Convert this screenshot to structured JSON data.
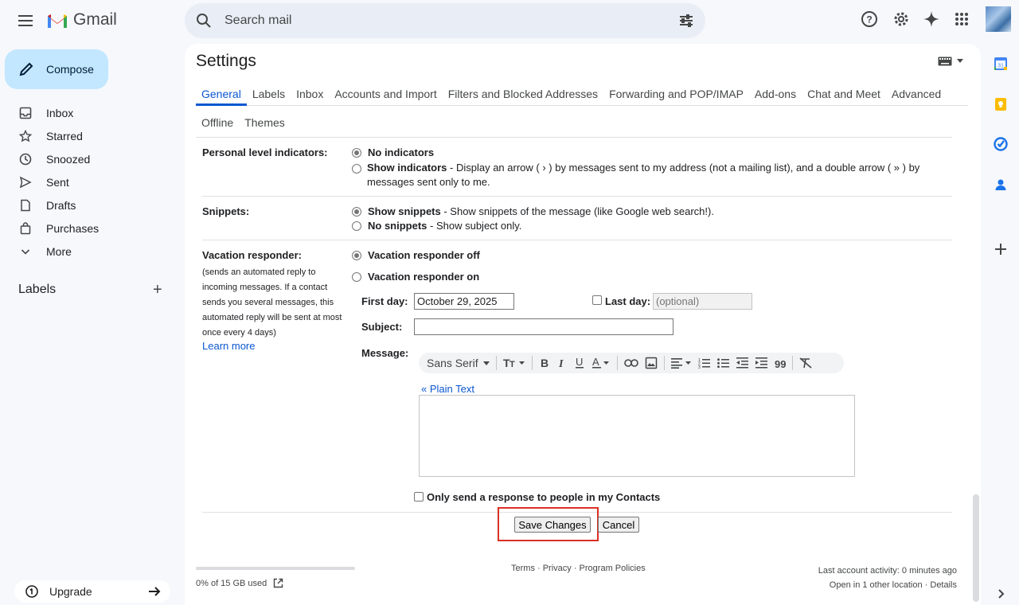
{
  "app": {
    "name": "Gmail"
  },
  "search": {
    "placeholder": "Search mail"
  },
  "icons": {
    "menu": "hamburger-icon",
    "help": "help-icon",
    "settings": "gear-icon",
    "gemini": "sparkle-icon",
    "apps": "apps-grid-icon"
  },
  "colors": {
    "accent": "#0b57d0",
    "compose_bg": "#c2e7ff",
    "highlight": "#d93025"
  },
  "compose": {
    "label": "Compose"
  },
  "nav": {
    "items": [
      {
        "label": "Inbox",
        "icon": "inbox-icon"
      },
      {
        "label": "Starred",
        "icon": "star-icon"
      },
      {
        "label": "Snoozed",
        "icon": "clock-icon"
      },
      {
        "label": "Sent",
        "icon": "send-icon"
      },
      {
        "label": "Drafts",
        "icon": "draft-icon"
      },
      {
        "label": "Purchases",
        "icon": "bag-icon"
      },
      {
        "label": "More",
        "icon": "chevron-down-icon"
      }
    ],
    "labels_heading": "Labels",
    "upgrade": "Upgrade"
  },
  "settings": {
    "title": "Settings",
    "tabs_row1": [
      "General",
      "Labels",
      "Inbox",
      "Accounts and Import",
      "Filters and Blocked Addresses",
      "Forwarding and POP/IMAP",
      "Add-ons",
      "Chat and Meet",
      "Advanced"
    ],
    "tabs_row2": [
      "Offline",
      "Themes"
    ],
    "active_tab": "General"
  },
  "personal": {
    "label": "Personal level indicators:",
    "opt1": "No indicators",
    "opt2": "Show indicators",
    "opt2_desc": " - Display an arrow ( › ) by messages sent to my address (not a mailing list), and a double arrow ( » ) by",
    "opt2_desc2": "messages sent only to me."
  },
  "snippets": {
    "label": "Snippets:",
    "opt1": "Show snippets",
    "opt1_desc": " - Show snippets of the message (like Google web search!).",
    "opt2": "No snippets",
    "opt2_desc": " - Show subject only."
  },
  "vacation": {
    "label": "Vacation responder:",
    "desc": "(sends an automated reply to incoming messages. If a contact sends you several messages, this automated reply will be sent at most once every 4 days)",
    "learn_more": "Learn more",
    "off": "Vacation responder off",
    "on": "Vacation responder on",
    "first_day_label": "First day:",
    "first_day_value": "October 29, 2025",
    "last_day_label": "Last day:",
    "last_day_placeholder": "(optional)",
    "subject_label": "Subject:",
    "message_label": "Message:",
    "font": "Sans Serif",
    "plain_text": "« Plain Text",
    "contacts_only": "Only send a response to people in my Contacts"
  },
  "buttons": {
    "save": "Save Changes",
    "cancel": "Cancel"
  },
  "footer": {
    "storage": "0% of 15 GB used",
    "storage_fraction": 0,
    "links": "Terms · Privacy · Program Policies",
    "activity1": "Last account activity: 0 minutes ago",
    "activity2": "Open in 1 other location · Details"
  }
}
